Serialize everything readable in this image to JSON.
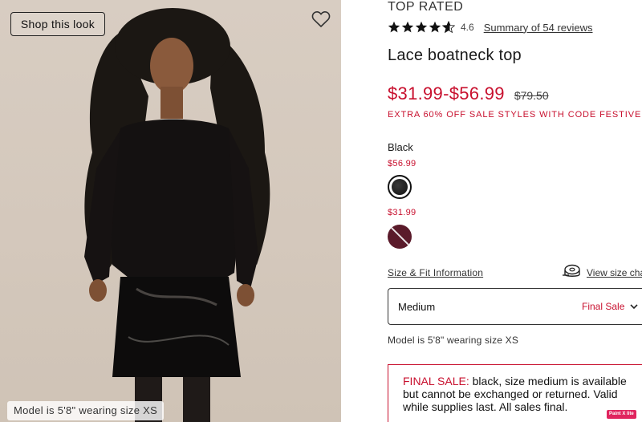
{
  "photo": {
    "shop_button": "Shop this look",
    "caption": "Model is 5'8\" wearing size XS",
    "favorite_icon": "heart-outline-icon"
  },
  "product": {
    "badge": "TOP RATED",
    "rating": "4.6",
    "rating_stars": 4.6,
    "reviews_link": "Summary of 54 reviews",
    "title": "Lace boatneck top",
    "price_range": "$31.99-$56.99",
    "original_price": "$79.50",
    "promo": "EXTRA 60% OFF SALE STYLES WITH CODE FESTIVE"
  },
  "color": {
    "label": "Black",
    "swatches": [
      {
        "price": "$56.99",
        "name": "black",
        "hex": "#111111",
        "selected": true
      },
      {
        "price": "$31.99",
        "name": "plum",
        "hex": "#5a1a2a",
        "unavailable": true
      }
    ]
  },
  "size": {
    "fit_link": "Size & Fit Information",
    "chart_icon": "measuring-tape-icon",
    "chart_link": "View size cha",
    "selected": "Medium",
    "selected_note": "Final Sale",
    "model_note": "Model is 5'8\" wearing size XS"
  },
  "alert": {
    "lead": "FINAL SALE:",
    "body": " black, size medium is available but cannot be exchanged or returned. Valid while supplies last. All sales final."
  },
  "extension_badge": "Paint X lite",
  "colors": {
    "sale_red": "#c8102e",
    "text": "#1a1a1a"
  }
}
